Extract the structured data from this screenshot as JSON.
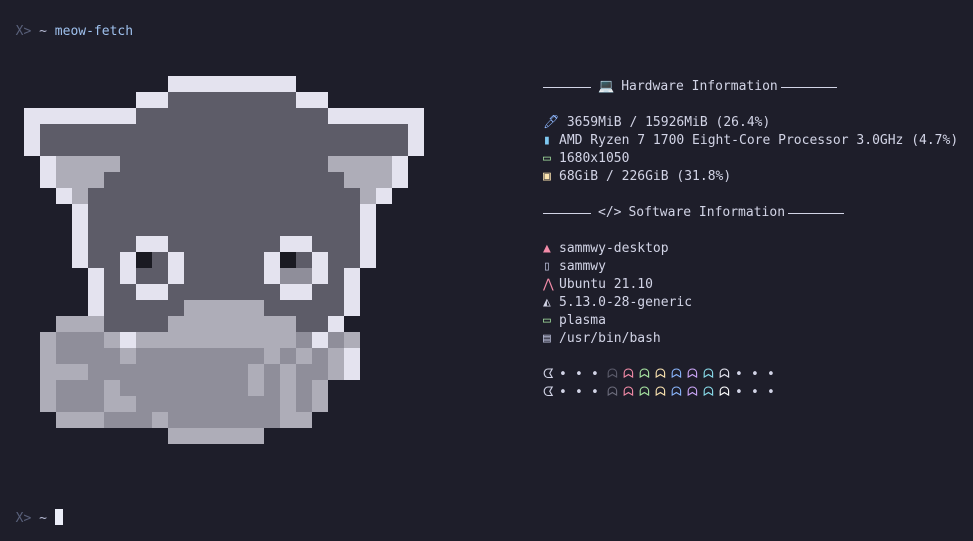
{
  "terminal": {
    "prompt_symbol": "X>",
    "prompt_tilde": "~",
    "command": "meow-fetch"
  },
  "hardware": {
    "header_icon": "💻",
    "header": "Hardware Information",
    "rows": [
      {
        "icon": "🖊",
        "icon_name": "memory-icon",
        "icon_color": "#8fb8ff",
        "text": " 3659MiB / 15926MiB (26.4%)"
      },
      {
        "icon": "▮",
        "icon_name": "cpu-icon",
        "icon_color": "#7ec8f0",
        "text": "AMD Ryzen 7 1700 Eight-Core Processor 3.0GHz (4.7%)"
      },
      {
        "icon": "▭",
        "icon_name": "display-icon",
        "icon_color": "#a6e3a1",
        "text": "1680x1050"
      },
      {
        "icon": "▣",
        "icon_name": "disk-icon",
        "icon_color": "#f9e2af",
        "text": "68GiB / 226GiB (31.8%)"
      }
    ]
  },
  "software": {
    "header_icon": "</>",
    "header": "Software Information",
    "rows": [
      {
        "icon": "▲",
        "icon_name": "host-icon",
        "icon_color": "#f38ba8",
        "text": "sammwy-desktop"
      },
      {
        "icon": "▯",
        "icon_name": "user-icon",
        "icon_color": "#b8bcd6",
        "text": "sammwy"
      },
      {
        "icon": "⋀",
        "icon_name": "ubuntu-icon",
        "icon_color": "#f38ba8",
        "text": "Ubuntu 21.10"
      },
      {
        "icon": "◭",
        "icon_name": "linux-icon",
        "icon_color": "#d2d4e6",
        "text": "5.13.0-28-generic"
      },
      {
        "icon": "▭",
        "icon_name": "desktop-icon",
        "icon_color": "#a6e3a1",
        "text": "plasma"
      },
      {
        "icon": "▤",
        "icon_name": "shell-icon",
        "icon_color": "#b8bcd6",
        "text": "/usr/bin/bash"
      }
    ]
  },
  "palette_rows": [
    {
      "pacman": "ᗧ",
      "dots_before": [
        "•",
        "•",
        "•"
      ],
      "ghosts": [
        "#5b5b6b",
        "#f38ba8",
        "#a6e3a1",
        "#f9e2af",
        "#89b4fa",
        "#cba6f7",
        "#89dceb",
        "#e6e6f0"
      ],
      "dots_after": [
        "•",
        "•",
        "•"
      ]
    },
    {
      "pacman": "ᗧ",
      "dots_before": [
        "•",
        "•",
        "•"
      ],
      "ghosts": [
        "#6c6c7c",
        "#f38ba8",
        "#a6e3a1",
        "#f9e2af",
        "#89b4fa",
        "#cba6f7",
        "#89dceb",
        "#ffffff"
      ],
      "dots_after": [
        "•",
        "•",
        "•"
      ]
    }
  ],
  "colors": {
    "background": "#1e1e2a",
    "text": "#d2d4e6",
    "cat_outline": "#e4e3ef",
    "cat_dark": "#5d5c68",
    "cat_mid": "#8f8e9a",
    "cat_light": "#aeadb8",
    "cat_black": "#1a1a22"
  }
}
